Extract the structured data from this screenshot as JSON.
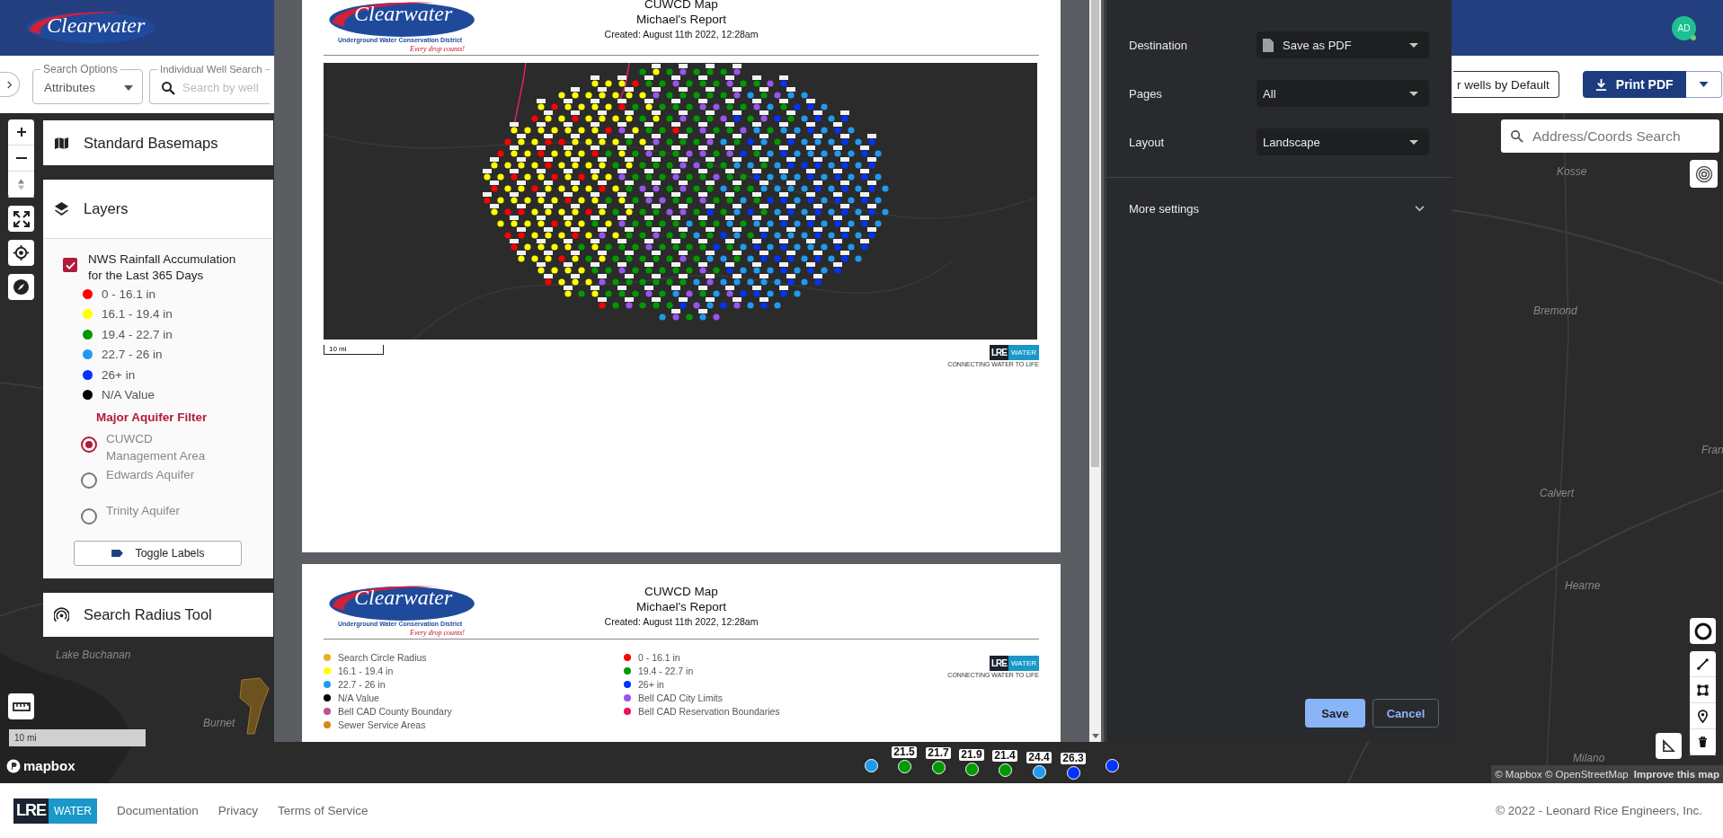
{
  "header": {
    "logo": "Clearwater",
    "avatar": {
      "initials": "AD",
      "online": true
    }
  },
  "toolbar": {
    "search_options": {
      "label": "Search Options",
      "value": "Attributes"
    },
    "well_search": {
      "label": "Individual Well Search",
      "placeholder": "Search by well"
    },
    "default_button": "r wells by Default",
    "print_button": "Print PDF"
  },
  "side_panel": {
    "basemaps_title": "Standard Basemaps",
    "layers_title": "Layers",
    "layer": {
      "name": "NWS Rainfall Accumulation for the Last 365 Days",
      "checked": true
    },
    "legend": [
      {
        "label": "0 - 16.1 in",
        "color": "#ff0000"
      },
      {
        "label": "16.1 - 19.4 in",
        "color": "#ffff00"
      },
      {
        "label": "19.4 - 22.7 in",
        "color": "#009900"
      },
      {
        "label": "22.7 - 26 in",
        "color": "#1e9bf0"
      },
      {
        "label": "26+ in",
        "color": "#0033ff"
      },
      {
        "label": "N/A Value",
        "color": "#000000"
      }
    ],
    "aquifer_filter": {
      "title": "Major Aquifer Filter",
      "options": [
        {
          "label": "CUWCD Management Area",
          "selected": true
        },
        {
          "label": "Edwards Aquifer",
          "selected": false
        },
        {
          "label": "Trinity Aquifer",
          "selected": false
        }
      ]
    },
    "toggle_labels": "Toggle Labels",
    "radius_tool_title": "Search Radius Tool"
  },
  "map": {
    "address_search": {
      "placeholder": "Address/Coords Search"
    },
    "place_labels": [
      "Lake Buchanan",
      "Burnet",
      "Kosse",
      "Bremond",
      "Calvert",
      "Hearne",
      "Milano",
      "Fran"
    ],
    "well_markers": [
      {
        "color": "#1e9bf0"
      },
      {
        "label": "21.5",
        "color": "#009900"
      },
      {
        "label": "21.7",
        "color": "#009900"
      },
      {
        "label": "21.9",
        "color": "#009900"
      },
      {
        "label": "21.4",
        "color": "#009900"
      },
      {
        "label": "24.4",
        "color": "#1e9bf0"
      },
      {
        "label": "26.3",
        "color": "#0033ff"
      },
      {
        "color": "#0033ff"
      }
    ],
    "scale": "10 mi",
    "mapbox_logo": "mapbox",
    "attribution": "© Mapbox © OpenStreetMap",
    "improve_link": "Improve this map"
  },
  "print_preview": {
    "pages": [
      {
        "kind": "map",
        "logo": "Clearwater",
        "logo_subtitle": "Underground Water Conservation District",
        "slogan": "Every drop counts!",
        "title": "CUWCD Map",
        "subtitle": "Michael's Report",
        "created": "Created: August 11th 2022, 12:28am",
        "scale": "10 mi",
        "partner_logo": {
          "left": "LRE",
          "right": "WATER",
          "tagline": "CONNECTING WATER TO LIFE"
        }
      },
      {
        "kind": "legend",
        "logo": "Clearwater",
        "logo_subtitle": "Underground Water Conservation District",
        "slogan": "Every drop counts!",
        "title": "CUWCD Map",
        "subtitle": "Michael's Report",
        "created": "Created: August 11th 2022, 12:28am",
        "partner_logo": {
          "left": "LRE",
          "right": "WATER",
          "tagline": "CONNECTING WATER TO LIFE"
        },
        "legend_columns": [
          [
            {
              "label": "Search Circle Radius",
              "color": "#e8b023"
            },
            {
              "label": "16.1 - 19.4 in",
              "color": "#ffff00"
            },
            {
              "label": "22.7 - 26 in",
              "color": "#1e9bf0"
            },
            {
              "label": "N/A Value",
              "color": "#000000"
            },
            {
              "label": "Bell CAD County Boundary",
              "color": "#c0508c"
            },
            {
              "label": "Sewer Service Areas",
              "color": "#d48a10"
            }
          ],
          [
            {
              "label": "0 - 16.1 in",
              "color": "#ff0000"
            },
            {
              "label": "19.4 - 22.7 in",
              "color": "#009900"
            },
            {
              "label": "26+ in",
              "color": "#0033ff"
            },
            {
              "label": "Bell CAD City Limits",
              "color": "#9955ee"
            },
            {
              "label": "Bell CAD Reservation Boundaries",
              "color": "#ee1155"
            }
          ]
        ]
      }
    ]
  },
  "print_dialog": {
    "settings": [
      {
        "label": "Destination",
        "value": "Save as PDF",
        "kind": "file"
      },
      {
        "label": "Pages",
        "value": "All",
        "kind": "plain"
      },
      {
        "label": "Layout",
        "value": "Landscape",
        "kind": "plain"
      }
    ],
    "more_settings": {
      "label": "More settings",
      "expanded": false
    },
    "buttons": [
      {
        "label": "Save",
        "kind": "primary"
      },
      {
        "label": "Cancel",
        "kind": "secondary"
      }
    ]
  },
  "footer": {
    "logo": {
      "left": "LRE",
      "right": "WATER"
    },
    "links": [
      "Documentation",
      "Privacy",
      "Terms of Service"
    ],
    "copyright": "© 2022 - Leonard Rice Engineers, Inc."
  }
}
